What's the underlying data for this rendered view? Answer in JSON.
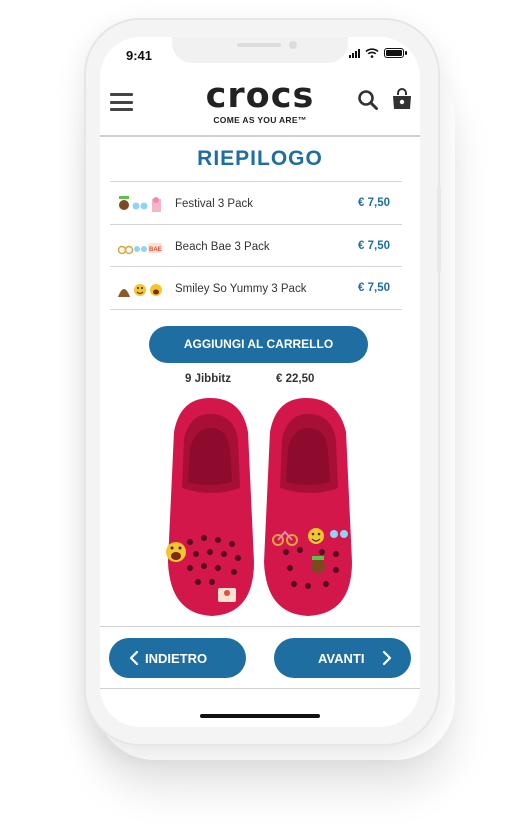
{
  "status_bar": {
    "time": "9:41"
  },
  "header": {
    "brand": "crocs",
    "tagline": "COME AS YOU ARE™",
    "menu_icon": "hamburger-menu-icon",
    "search_icon": "search-icon",
    "cart_icon": "shopping-bag-icon"
  },
  "summary": {
    "title": "RIEPILOGO",
    "items": [
      {
        "name": "Festival 3 Pack",
        "price": "€ 7,50"
      },
      {
        "name": "Beach Bae 3 Pack",
        "price": "€ 7,50"
      },
      {
        "name": "Smiley So Yummy 3 Pack",
        "price": "€ 7,50"
      }
    ],
    "add_to_cart_label": "AGGIUNGI AL CARRELLO",
    "count_label": "9 Jibbitz",
    "total": "€ 22,50"
  },
  "navigation": {
    "back_label": "INDIETRO",
    "next_label": "AVANTI"
  },
  "colors": {
    "brand_blue": "#1f6ea1",
    "shoe_red": "#d4174a"
  }
}
